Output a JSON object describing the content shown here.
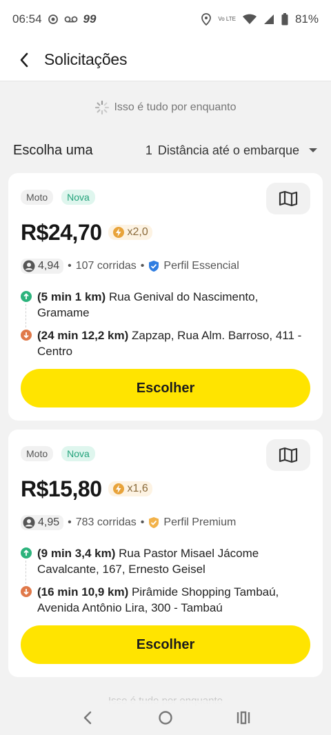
{
  "status_bar": {
    "time": "06:54",
    "app_badge": "99",
    "battery": "81%",
    "volte_label": "Vo LTE"
  },
  "header": {
    "title": "Solicitações"
  },
  "loading_text": "Isso é tudo por enquanto",
  "sort": {
    "label": "Escolha uma",
    "count": "1",
    "option": "Distância até o embarque"
  },
  "requests": [
    {
      "type": "Moto",
      "badge": "Nova",
      "price": "R$24,70",
      "multiplier": "x2,0",
      "rating": "4,94",
      "rides": "107 corridas",
      "profile": "Perfil Essencial",
      "profile_color": "#2f7de1",
      "pickup_eta": "(5 min 1 km)",
      "pickup_address": "Rua Genival do Nascimento, Gramame",
      "dropoff_eta": "(24 min 12,2 km)",
      "dropoff_address": "Zapzap, Rua Alm. Barroso, 411 - Centro",
      "button_label": "Escolher"
    },
    {
      "type": "Moto",
      "badge": "Nova",
      "price": "R$15,80",
      "multiplier": "x1,6",
      "rating": "4,95",
      "rides": "783 corridas",
      "profile": "Perfil Premium",
      "profile_color": "#f2b24a",
      "pickup_eta": "(9 min 3,4 km)",
      "pickup_address": "Rua Pastor Misael Jácome Cavalcante, 167, Ernesto Geisel",
      "dropoff_eta": "(16 min 10,9 km)",
      "dropoff_address": "Pirâmide Shopping Tambaú, Avenida Antônio Lira, 300 - Tambaú",
      "button_label": "Escolher"
    }
  ],
  "footer_text": "Isso é tudo por enquanto",
  "colors": {
    "accent_yellow": "#ffe400",
    "pickup_green": "#2cb37c",
    "dropoff_orange": "#e0794a",
    "new_badge": "#22a27a"
  }
}
